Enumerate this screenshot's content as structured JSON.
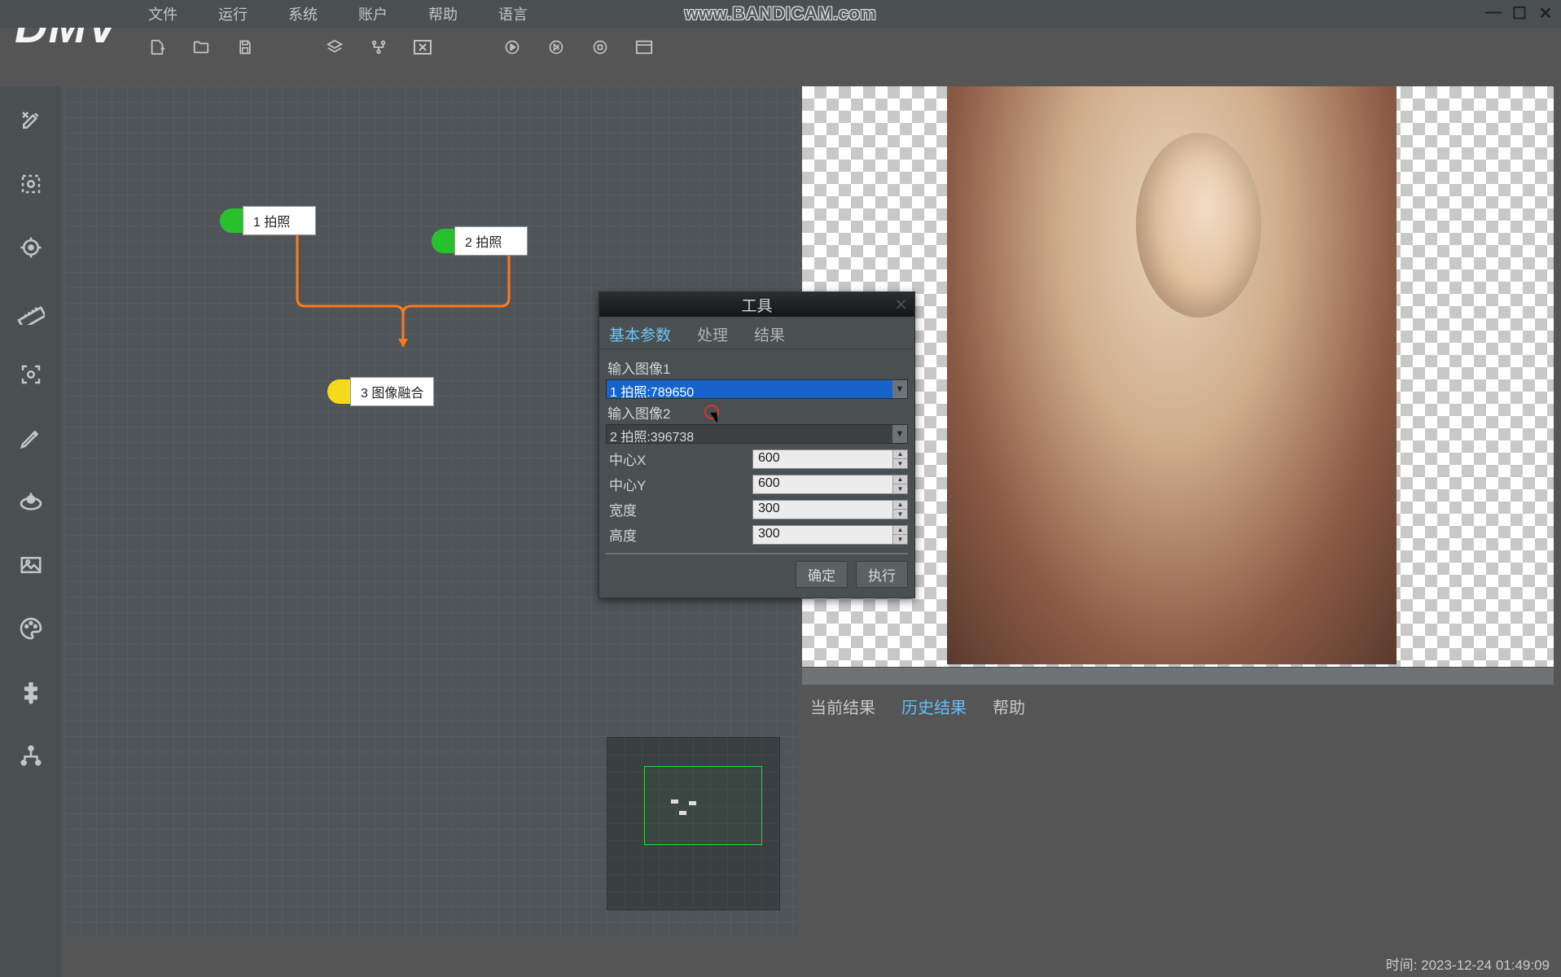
{
  "logo": "DMV",
  "watermark": "www.BANDICAM.com",
  "menu": {
    "items": [
      "文件",
      "运行",
      "系统",
      "账户",
      "帮助",
      "语言"
    ]
  },
  "win": {
    "min": "—",
    "max": "☐",
    "close": "✕"
  },
  "nodes": {
    "n1": "1 拍照",
    "n2": "2 拍照",
    "n3": "3 图像融合"
  },
  "dialog": {
    "title": "工具",
    "tabs": {
      "t0": "基本参数",
      "t1": "处理",
      "t2": "结果"
    },
    "input1_label": "输入图像1",
    "input1_value": "1 拍照:789650",
    "input2_label": "输入图像2",
    "input2_value": "2 拍照:396738",
    "params": {
      "centerX_label": "中心X",
      "centerX_value": "600",
      "centerY_label": "中心Y",
      "centerY_value": "600",
      "width_label": "宽度",
      "width_value": "300",
      "height_label": "高度",
      "height_value": "300"
    },
    "ok": "确定",
    "exec": "执行"
  },
  "result_tabs": {
    "cur": "当前结果",
    "hist": "历史结果",
    "help": "帮助"
  },
  "status": "时间: 2023-12-24 01:49:09"
}
